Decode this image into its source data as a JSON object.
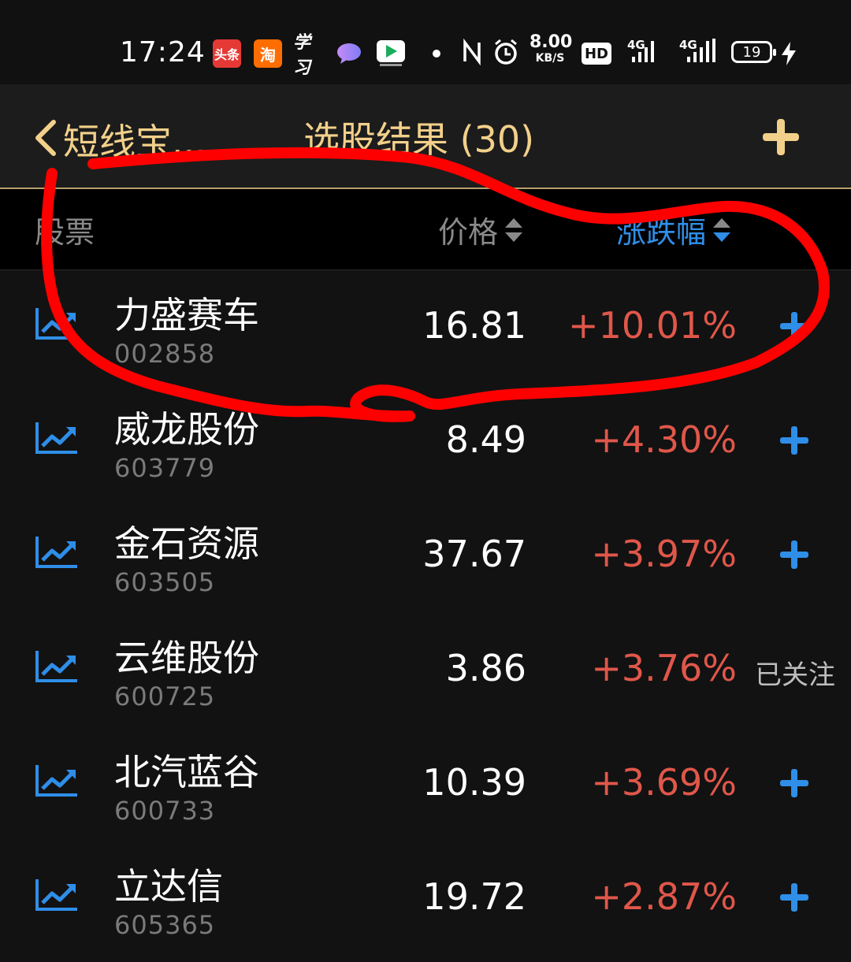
{
  "status_bar": {
    "time": "17:24",
    "app_icons": [
      {
        "name": "toutiao-icon",
        "label": "头条"
      },
      {
        "name": "taobao-icon",
        "label": "淘"
      },
      {
        "name": "xuexi-icon",
        "label": "学习"
      }
    ],
    "net_speed_value": "8.00",
    "net_speed_unit": "KB/S",
    "hd_label": "HD",
    "network_1": "4G",
    "network_2": "4G",
    "battery": "19"
  },
  "nav": {
    "back_label": "短线宝...",
    "title": "选股结果 (30)"
  },
  "table_header": {
    "stock": "股票",
    "price": "价格",
    "change": "涨跌幅"
  },
  "colors": {
    "accent_gold": "#f2d08a",
    "up_red": "#e0574a",
    "link_blue": "#2f8ee8",
    "annotation_red": "#ff0000"
  },
  "rows": [
    {
      "name": "力盛赛车",
      "code": "002858",
      "price": "16.81",
      "change": "+10.01%",
      "followed": false,
      "followed_label": ""
    },
    {
      "name": "威龙股份",
      "code": "603779",
      "price": "8.49",
      "change": "+4.30%",
      "followed": false,
      "followed_label": ""
    },
    {
      "name": "金石资源",
      "code": "603505",
      "price": "37.67",
      "change": "+3.97%",
      "followed": false,
      "followed_label": ""
    },
    {
      "name": "云维股份",
      "code": "600725",
      "price": "3.86",
      "change": "+3.76%",
      "followed": true,
      "followed_label": "已关注"
    },
    {
      "name": "北汽蓝谷",
      "code": "600733",
      "price": "10.39",
      "change": "+3.69%",
      "followed": false,
      "followed_label": ""
    },
    {
      "name": "立达信",
      "code": "605365",
      "price": "19.72",
      "change": "+2.87%",
      "followed": false,
      "followed_label": ""
    }
  ]
}
